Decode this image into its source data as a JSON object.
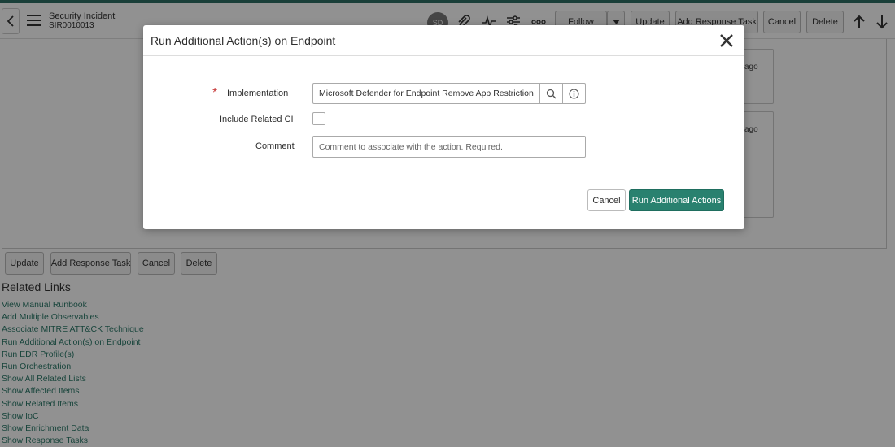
{
  "header": {
    "record_type": "Security Incident",
    "record_number": "SIR0010013",
    "avatar_initials": "SD",
    "buttons": {
      "follow": "Follow",
      "update": "Update",
      "add_response_task": "Add Response Task",
      "cancel": "Cancel",
      "delete": "Delete"
    }
  },
  "activity": {
    "entries": [
      {
        "time_suffix": "ago"
      },
      {
        "time_suffix": "ago"
      }
    ]
  },
  "form_buttons": {
    "update": "Update",
    "add_response_task": "Add Response Task",
    "cancel": "Cancel",
    "delete": "Delete"
  },
  "related_links": {
    "title": "Related Links",
    "items": [
      "View Manual Runbook",
      "Add Multiple Observables",
      "Associate MITRE ATT&CK Technique",
      "Run Additional Action(s) on Endpoint",
      "Run EDR Profile(s)",
      "Run Orchestration",
      "Show All Related Lists",
      "Show Affected Items",
      "Show Related Items",
      "Show IoC",
      "Show Enrichment Data",
      "Show Response Tasks"
    ]
  },
  "modal": {
    "title": "Run Additional Action(s) on Endpoint",
    "implementation_label": "Implementation",
    "required_marker": "*",
    "implementation_value": "Microsoft Defender for Endpoint Remove App Restriction",
    "include_related_ci_label": "Include Related CI",
    "include_related_ci_checked": false,
    "comment_label": "Comment",
    "comment_placeholder": "Comment to associate with the action. Required.",
    "cancel_label": "Cancel",
    "run_label": "Run Additional Actions"
  },
  "colors": {
    "primary_button": "#29816f",
    "link": "#2c7a6a",
    "required": "#c83c3c",
    "top_strip": "#2f6f64"
  }
}
